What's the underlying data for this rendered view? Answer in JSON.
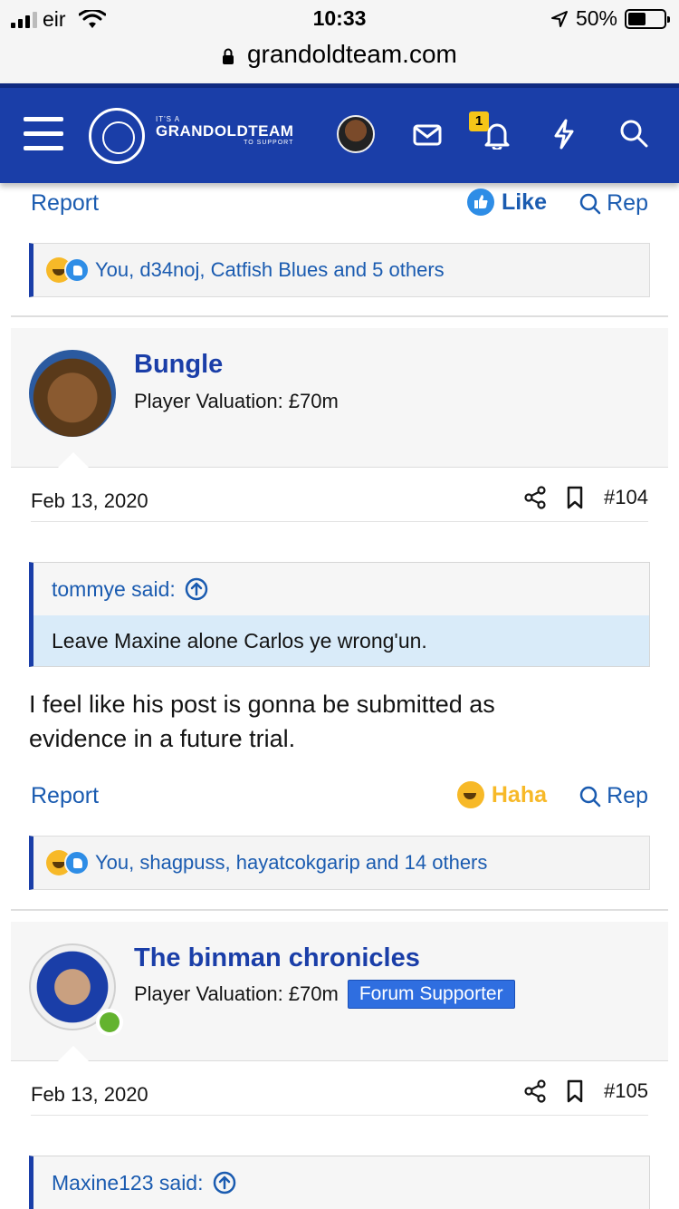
{
  "status_bar": {
    "carrier": "eir",
    "time": "10:33",
    "battery": "50%",
    "battery_fill": 0.5
  },
  "browser": {
    "url": "grandoldteam.com"
  },
  "header": {
    "brand_top": "IT'S A",
    "brand_name": "GRANDOLDTEAM",
    "brand_bottom": "TO SUPPORT",
    "alerts_count": "1"
  },
  "prev_post": {
    "report_label": "Report",
    "reaction_label": "Like",
    "reply_label": "Rep",
    "reactions_summary": "You, d34noj, Catfish Blues and 5 others"
  },
  "posts": [
    {
      "author": "Bungle",
      "valuation": "Player Valuation: £70m",
      "date": "Feb 13, 2020",
      "number": "#104",
      "quote_author": "tommye said:",
      "quote_text": "Leave Maxine alone Carlos ye wrong'un.",
      "body_line1": "I feel like his post is gonna be submitted as",
      "body_line2": "evidence in a future trial.",
      "report_label": "Report",
      "reaction_label": "Haha",
      "reply_label": "Rep",
      "reactions_summary": "You, shagpuss, hayatcokgarip and 14 others"
    },
    {
      "author": "The binman chronicles",
      "valuation": "Player Valuation: £70m",
      "badge": "Forum Supporter",
      "date": "Feb 13, 2020",
      "number": "#105",
      "quote_author": "Maxine123 said:"
    }
  ],
  "colors": {
    "brand_blue": "#1a3ea8",
    "link_blue": "#1a5bb0",
    "haha_yellow": "#f7b928",
    "like_blue": "#2e8de6",
    "quote_bg": "#d9ebf9"
  }
}
